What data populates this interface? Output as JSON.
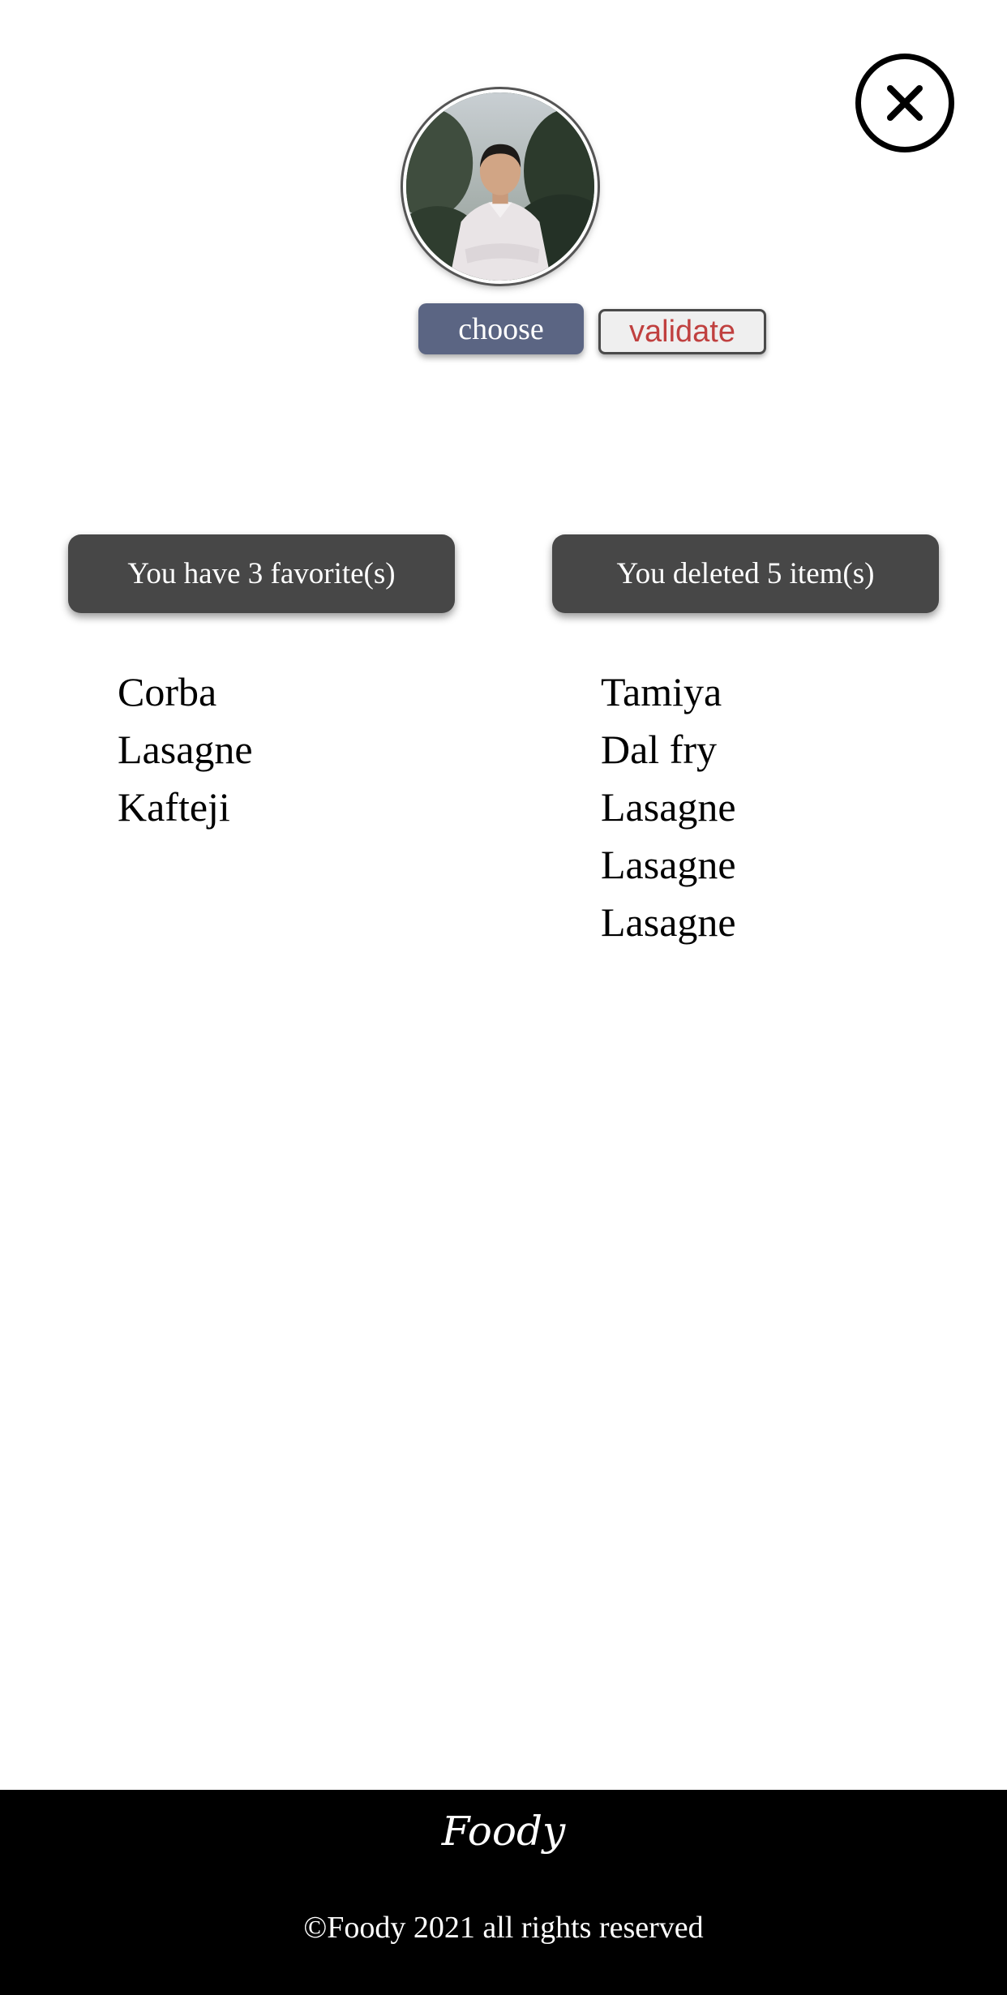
{
  "profile": {
    "close_icon": "close-icon",
    "avatar_icon": "user-photo",
    "choose_label": "choose",
    "validate_label": "validate"
  },
  "favorites": {
    "header": "You have 3 favorite(s)",
    "items": [
      "Corba",
      "Lasagne",
      "Kafteji"
    ]
  },
  "deleted": {
    "header": "You deleted 5 item(s)",
    "items": [
      "Tamiya",
      "Dal fry",
      "Lasagne",
      "Lasagne",
      "Lasagne"
    ]
  },
  "footer": {
    "brand": "Foody",
    "copyright": "©Foody 2021 all rights reserved"
  },
  "colors": {
    "choose_bg": "#5b6583",
    "validate_text": "#c0403f",
    "header_bg": "#474747",
    "footer_bg": "#000000"
  }
}
